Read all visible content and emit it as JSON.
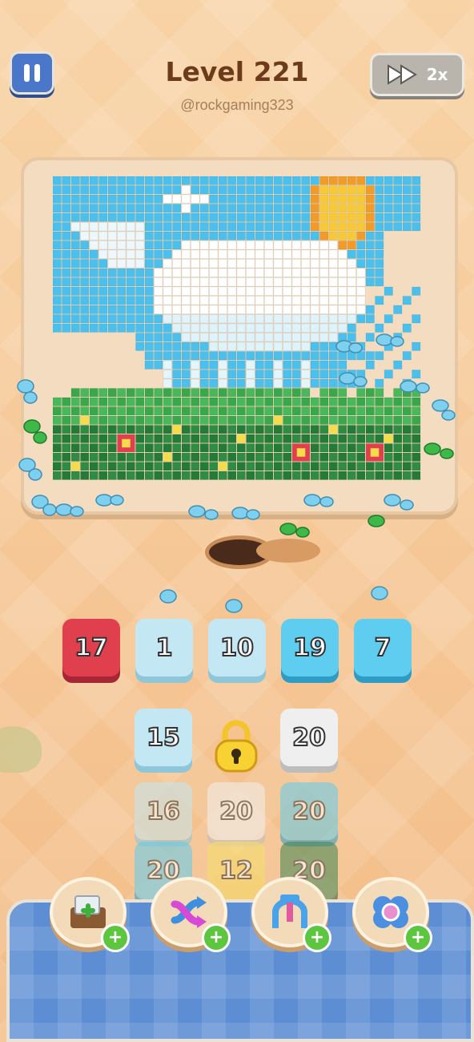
{
  "header": {
    "level_title": "Level 221",
    "handle": "@rockgaming323",
    "speed_label": "2x"
  },
  "icons": {
    "pause": "pause-icon",
    "speed": "fast-forward-icon",
    "lock": "padlock-icon"
  },
  "puzzle": {
    "picture": "pixel whale with sun, cloud and grass",
    "colors": {
      "sky": "#4cc0ec",
      "whale": "#ffffff",
      "sun": "#f8c937",
      "sun_edge": "#f09b2a",
      "grass": "#3aa84a",
      "grass_dark": "#267a38",
      "flower": "#e0404e"
    }
  },
  "slots": [
    {
      "value": "17",
      "color": "red"
    },
    {
      "value": "1",
      "color": "pale-blue"
    },
    {
      "value": "10",
      "color": "pale-blue"
    },
    {
      "value": "19",
      "color": "sky-blue"
    },
    {
      "value": "7",
      "color": "sky-blue"
    }
  ],
  "queue": {
    "row1": [
      {
        "value": "15",
        "color": "pale-blue"
      },
      {
        "value": "locked",
        "color": "yellow"
      },
      {
        "value": "20",
        "color": "white"
      }
    ],
    "row2": [
      {
        "value": "16",
        "color": "pale-blue"
      },
      {
        "value": "20",
        "color": "white"
      },
      {
        "value": "20",
        "color": "sky-blue"
      }
    ],
    "row3": [
      {
        "value": "20",
        "color": "sky-blue"
      },
      {
        "value": "12",
        "color": "yellow"
      },
      {
        "value": "20",
        "color": "green"
      }
    ]
  },
  "boosters": [
    {
      "name": "add-tray",
      "icon": "add-box-icon"
    },
    {
      "name": "shuffle",
      "icon": "shuffle-arrows-icon"
    },
    {
      "name": "magnet",
      "icon": "magnet-claw-icon"
    },
    {
      "name": "freeze",
      "icon": "flower-freeze-icon"
    }
  ],
  "booster_add_label": "+"
}
